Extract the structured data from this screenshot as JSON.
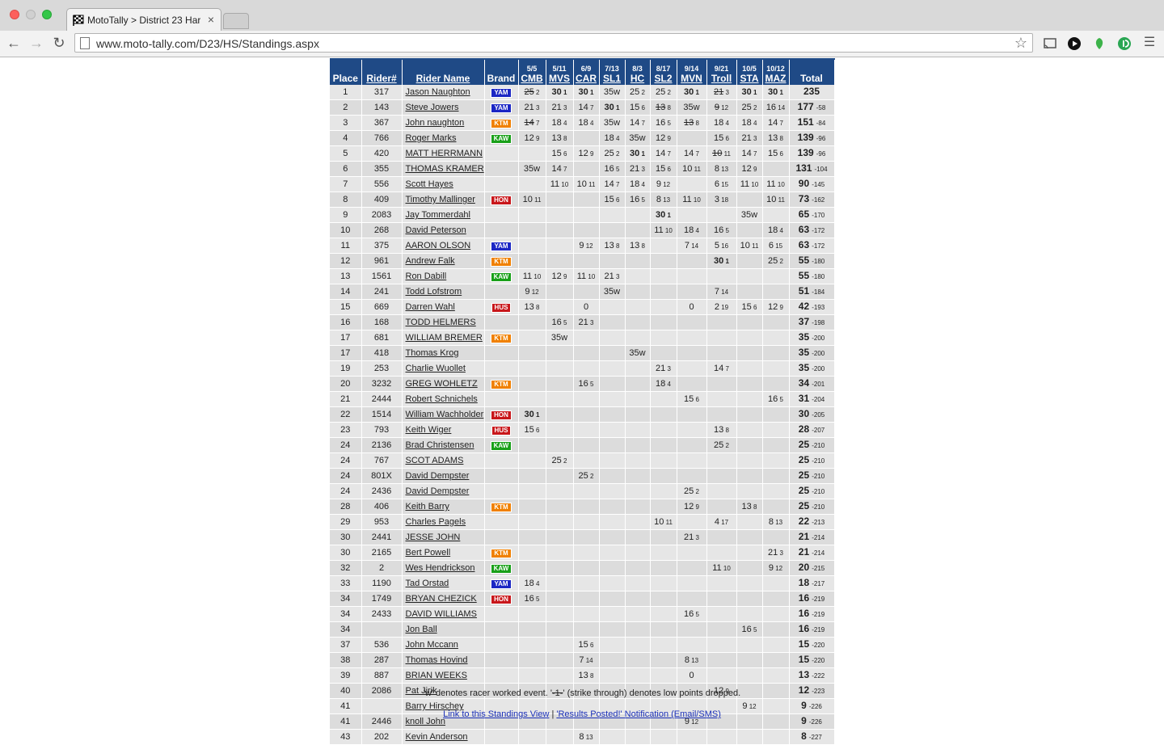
{
  "browser": {
    "tab_title": "MotoTally > District 23 Har",
    "tab_close": "×",
    "url": "www.moto-tally.com/D23/HS/Standings.aspx"
  },
  "colors": {
    "header_bg": "#1f4a86",
    "YAM": "#1c27c4",
    "KTM": "#f08000",
    "KAW": "#19a019",
    "HON": "#c8171b",
    "HUS": "#c8171b"
  },
  "headers": {
    "place": "Place",
    "rider_num": "Rider#",
    "rider_name": "Rider Name",
    "brand": "Brand",
    "total": "Total"
  },
  "events": [
    {
      "date": "5/5",
      "venue": "CMB"
    },
    {
      "date": "5/11",
      "venue": "MVS"
    },
    {
      "date": "6/9",
      "venue": "CAR"
    },
    {
      "date": "7/13",
      "venue": "SL1"
    },
    {
      "date": "8/3",
      "venue": "HC"
    },
    {
      "date": "8/17",
      "venue": "SL2"
    },
    {
      "date": "9/14",
      "venue": "MVN"
    },
    {
      "date": "9/21",
      "venue": "Troll"
    },
    {
      "date": "10/5",
      "venue": "STA"
    },
    {
      "date": "10/12",
      "venue": "MAZ"
    }
  ],
  "riders": [
    {
      "place": "1",
      "num": "317",
      "name": "Jason Naughton",
      "brand": "YAM",
      "scores": [
        "~25 2",
        "*30 1",
        "*30 1",
        "35w",
        "25 2",
        "25 2",
        "*30 1",
        "~21 3",
        "*30 1",
        "*30 1"
      ],
      "total": "235",
      "behind": ""
    },
    {
      "place": "2",
      "num": "143",
      "name": "Steve Jowers",
      "brand": "YAM",
      "scores": [
        "21 3",
        "21 3",
        "14 7",
        "*30 1",
        "15 6",
        "~13 8",
        "35w",
        "~9 12",
        "25 2",
        "16 14"
      ],
      "total": "177",
      "behind": "-58"
    },
    {
      "place": "3",
      "num": "367",
      "name": "John naughton",
      "brand": "KTM",
      "scores": [
        "~14 7",
        "18 4",
        "18 4",
        "35w",
        "14 7",
        "16 5",
        "~13 8",
        "18 4",
        "18 4",
        "14 7"
      ],
      "total": "151",
      "behind": "-84"
    },
    {
      "place": "4",
      "num": "766",
      "name": "Roger Marks",
      "brand": "KAW",
      "scores": [
        "12 9",
        "13 8",
        "",
        "18 4",
        "35w",
        "12 9",
        "",
        "15 6",
        "21 3",
        "13 8"
      ],
      "total": "139",
      "behind": "-96"
    },
    {
      "place": "5",
      "num": "420",
      "name": "MATT HERRMANN",
      "brand": "",
      "scores": [
        "",
        "15 6",
        "12 9",
        "25 2",
        "*30 1",
        "14 7",
        "14 7",
        "~10 11",
        "14 7",
        "15 6"
      ],
      "total": "139",
      "behind": "-96"
    },
    {
      "place": "6",
      "num": "355",
      "name": "THOMAS KRAMER",
      "brand": "",
      "scores": [
        "35w",
        "14 7",
        "",
        "16 5",
        "21 3",
        "15 6",
        "10 11",
        "8 13",
        "12 9",
        ""
      ],
      "total": "131",
      "behind": "-104"
    },
    {
      "place": "7",
      "num": "556",
      "name": "Scott Hayes",
      "brand": "",
      "scores": [
        "",
        "11 10",
        "10 11",
        "14 7",
        "18 4",
        "9 12",
        "",
        "6 15",
        "11 10",
        "11 10"
      ],
      "total": "90",
      "behind": "-145"
    },
    {
      "place": "8",
      "num": "409",
      "name": "Timothy Mallinger",
      "brand": "HON",
      "scores": [
        "10 11",
        "",
        "",
        "15 6",
        "16 5",
        "8 13",
        "11 10",
        "3 18",
        "",
        "10 11"
      ],
      "total": "73",
      "behind": "-162"
    },
    {
      "place": "9",
      "num": "2083",
      "name": "Jay Tommerdahl",
      "brand": "",
      "scores": [
        "",
        "",
        "",
        "",
        "",
        "*30 1",
        "",
        "",
        "35w",
        ""
      ],
      "total": "65",
      "behind": "-170"
    },
    {
      "place": "10",
      "num": "268",
      "name": "David Peterson",
      "brand": "",
      "scores": [
        "",
        "",
        "",
        "",
        "",
        "11 10",
        "18 4",
        "16 5",
        "",
        "18 4"
      ],
      "total": "63",
      "behind": "-172"
    },
    {
      "place": "11",
      "num": "375",
      "name": "AARON OLSON",
      "brand": "YAM",
      "scores": [
        "",
        "",
        "9 12",
        "13 8",
        "13 8",
        "",
        "7 14",
        "5 16",
        "10 11",
        "6 15"
      ],
      "total": "63",
      "behind": "-172"
    },
    {
      "place": "12",
      "num": "961",
      "name": "Andrew Falk",
      "brand": "KTM",
      "scores": [
        "",
        "",
        "",
        "",
        "",
        "",
        "",
        "*30 1",
        "",
        "25 2"
      ],
      "total": "55",
      "behind": "-180"
    },
    {
      "place": "13",
      "num": "1561",
      "name": "Ron Dabill",
      "brand": "KAW",
      "scores": [
        "11 10",
        "12 9",
        "11 10",
        "21 3",
        "",
        "",
        "",
        "",
        "",
        ""
      ],
      "total": "55",
      "behind": "-180"
    },
    {
      "place": "14",
      "num": "241",
      "name": "Todd Lofstrom",
      "brand": "",
      "scores": [
        "9 12",
        "",
        "",
        "35w",
        "",
        "",
        "",
        "7 14",
        "",
        ""
      ],
      "total": "51",
      "behind": "-184"
    },
    {
      "place": "15",
      "num": "669",
      "name": "Darren Wahl",
      "brand": "HUS",
      "scores": [
        "13 8",
        "",
        "0",
        "",
        "",
        "",
        "0",
        "2 19",
        "15 6",
        "12 9"
      ],
      "total": "42",
      "behind": "-193"
    },
    {
      "place": "16",
      "num": "168",
      "name": "TODD HELMERS",
      "brand": "",
      "scores": [
        "",
        "16 5",
        "21 3",
        "",
        "",
        "",
        "",
        "",
        "",
        ""
      ],
      "total": "37",
      "behind": "-198"
    },
    {
      "place": "17",
      "num": "681",
      "name": "WILLIAM BREMER",
      "brand": "KTM",
      "scores": [
        "",
        "35w",
        "",
        "",
        "",
        "",
        "",
        "",
        "",
        ""
      ],
      "total": "35",
      "behind": "-200"
    },
    {
      "place": "17",
      "num": "418",
      "name": "Thomas Krog",
      "brand": "",
      "scores": [
        "",
        "",
        "",
        "",
        "35w",
        "",
        "",
        "",
        "",
        ""
      ],
      "total": "35",
      "behind": "-200"
    },
    {
      "place": "19",
      "num": "253",
      "name": "Charlie Wuollet",
      "brand": "",
      "scores": [
        "",
        "",
        "",
        "",
        "",
        "21 3",
        "",
        "14 7",
        "",
        ""
      ],
      "total": "35",
      "behind": "-200"
    },
    {
      "place": "20",
      "num": "3232",
      "name": "GREG WOHLETZ",
      "brand": "KTM",
      "scores": [
        "",
        "",
        "16 5",
        "",
        "",
        "18 4",
        "",
        "",
        "",
        ""
      ],
      "total": "34",
      "behind": "-201"
    },
    {
      "place": "21",
      "num": "2444",
      "name": "Robert Schnichels",
      "brand": "",
      "scores": [
        "",
        "",
        "",
        "",
        "",
        "",
        "15 6",
        "",
        "",
        "16 5"
      ],
      "total": "31",
      "behind": "-204"
    },
    {
      "place": "22",
      "num": "1514",
      "name": "William Wachholder",
      "brand": "HON",
      "scores": [
        "*30 1",
        "",
        "",
        "",
        "",
        "",
        "",
        "",
        "",
        ""
      ],
      "total": "30",
      "behind": "-205"
    },
    {
      "place": "23",
      "num": "793",
      "name": "Keith Wiger",
      "brand": "HUS",
      "scores": [
        "15 6",
        "",
        "",
        "",
        "",
        "",
        "",
        "13 8",
        "",
        ""
      ],
      "total": "28",
      "behind": "-207"
    },
    {
      "place": "24",
      "num": "2136",
      "name": "Brad Christensen",
      "brand": "KAW",
      "scores": [
        "",
        "",
        "",
        "",
        "",
        "",
        "",
        "25 2",
        "",
        ""
      ],
      "total": "25",
      "behind": "-210"
    },
    {
      "place": "24",
      "num": "767",
      "name": "SCOT ADAMS",
      "brand": "",
      "scores": [
        "",
        "25 2",
        "",
        "",
        "",
        "",
        "",
        "",
        "",
        ""
      ],
      "total": "25",
      "behind": "-210"
    },
    {
      "place": "24",
      "num": "801X",
      "name": "David Dempster",
      "brand": "",
      "scores": [
        "",
        "",
        "25 2",
        "",
        "",
        "",
        "",
        "",
        "",
        ""
      ],
      "total": "25",
      "behind": "-210"
    },
    {
      "place": "24",
      "num": "2436",
      "name": "David Dempster",
      "brand": "",
      "scores": [
        "",
        "",
        "",
        "",
        "",
        "",
        "25 2",
        "",
        "",
        ""
      ],
      "total": "25",
      "behind": "-210"
    },
    {
      "place": "28",
      "num": "406",
      "name": "Keith Barry",
      "brand": "KTM",
      "scores": [
        "",
        "",
        "",
        "",
        "",
        "",
        "12 9",
        "",
        "13 8",
        ""
      ],
      "total": "25",
      "behind": "-210"
    },
    {
      "place": "29",
      "num": "953",
      "name": "Charles Pagels",
      "brand": "",
      "scores": [
        "",
        "",
        "",
        "",
        "",
        "10 11",
        "",
        "4 17",
        "",
        "8 13"
      ],
      "total": "22",
      "behind": "-213"
    },
    {
      "place": "30",
      "num": "2441",
      "name": "JESSE JOHN",
      "brand": "",
      "scores": [
        "",
        "",
        "",
        "",
        "",
        "",
        "21 3",
        "",
        "",
        ""
      ],
      "total": "21",
      "behind": "-214"
    },
    {
      "place": "30",
      "num": "2165",
      "name": "Bert Powell",
      "brand": "KTM",
      "scores": [
        "",
        "",
        "",
        "",
        "",
        "",
        "",
        "",
        "",
        "21 3"
      ],
      "total": "21",
      "behind": "-214"
    },
    {
      "place": "32",
      "num": "2",
      "name": "Wes Hendrickson",
      "brand": "KAW",
      "scores": [
        "",
        "",
        "",
        "",
        "",
        "",
        "",
        "11 10",
        "",
        "9 12"
      ],
      "total": "20",
      "behind": "-215"
    },
    {
      "place": "33",
      "num": "1190",
      "name": "Tad Orstad",
      "brand": "YAM",
      "scores": [
        "18 4",
        "",
        "",
        "",
        "",
        "",
        "",
        "",
        "",
        ""
      ],
      "total": "18",
      "behind": "-217"
    },
    {
      "place": "34",
      "num": "1749",
      "name": "BRYAN CHEZICK",
      "brand": "HON",
      "scores": [
        "16 5",
        "",
        "",
        "",
        "",
        "",
        "",
        "",
        "",
        ""
      ],
      "total": "16",
      "behind": "-219"
    },
    {
      "place": "34",
      "num": "2433",
      "name": "DAVID WILLIAMS",
      "brand": "",
      "scores": [
        "",
        "",
        "",
        "",
        "",
        "",
        "16 5",
        "",
        "",
        ""
      ],
      "total": "16",
      "behind": "-219"
    },
    {
      "place": "34",
      "num": "",
      "name": "Jon Ball",
      "brand": "",
      "scores": [
        "",
        "",
        "",
        "",
        "",
        "",
        "",
        "",
        "16 5",
        ""
      ],
      "total": "16",
      "behind": "-219"
    },
    {
      "place": "37",
      "num": "536",
      "name": "John Mccann",
      "brand": "",
      "scores": [
        "",
        "",
        "15 6",
        "",
        "",
        "",
        "",
        "",
        "",
        ""
      ],
      "total": "15",
      "behind": "-220"
    },
    {
      "place": "38",
      "num": "287",
      "name": "Thomas Hovind",
      "brand": "",
      "scores": [
        "",
        "",
        "7 14",
        "",
        "",
        "",
        "8 13",
        "",
        "",
        ""
      ],
      "total": "15",
      "behind": "-220"
    },
    {
      "place": "39",
      "num": "887",
      "name": "BRIAN WEEKS",
      "brand": "",
      "scores": [
        "",
        "",
        "13 8",
        "",
        "",
        "",
        "0",
        "",
        "",
        ""
      ],
      "total": "13",
      "behind": "-222"
    },
    {
      "place": "40",
      "num": "2086",
      "name": "Pat Jirik",
      "brand": "",
      "scores": [
        "",
        "",
        "",
        "",
        "",
        "",
        "",
        "12 9",
        "",
        ""
      ],
      "total": "12",
      "behind": "-223"
    },
    {
      "place": "41",
      "num": "",
      "name": "Barry Hirschey",
      "brand": "",
      "scores": [
        "",
        "",
        "",
        "",
        "",
        "",
        "",
        "",
        "9 12",
        ""
      ],
      "total": "9",
      "behind": "-226"
    },
    {
      "place": "41",
      "num": "2446",
      "name": "knoll John",
      "brand": "",
      "scores": [
        "",
        "",
        "",
        "",
        "",
        "",
        "9 12",
        "",
        "",
        ""
      ],
      "total": "9",
      "behind": "-226"
    },
    {
      "place": "43",
      "num": "202",
      "name": "Kevin Anderson",
      "brand": "",
      "scores": [
        "",
        "",
        "8 13",
        "",
        "",
        "",
        "",
        "",
        "",
        ""
      ],
      "total": "8",
      "behind": "-227"
    }
  ],
  "footnote": {
    "pre": "'w' denotes racer worked event.  '",
    "strike": "-1-",
    "post": "' (strike through) denotes low points dropped."
  },
  "links": {
    "standings_link": "Link to this Standings View",
    "separator": " | ",
    "notify_link": "'Results Posted!' Notification (Email/SMS)"
  }
}
